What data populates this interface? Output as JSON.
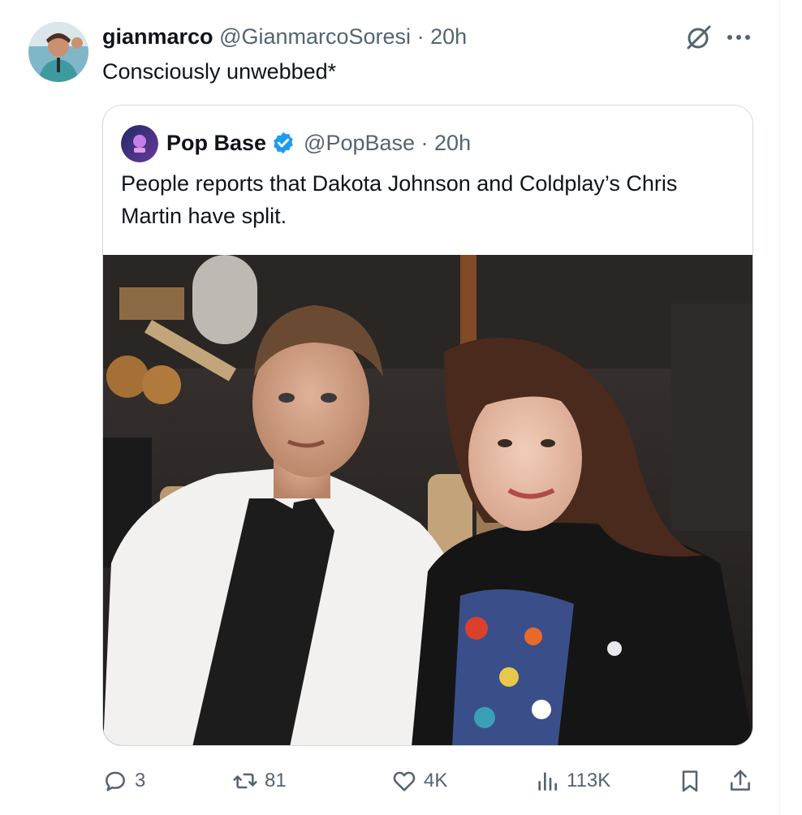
{
  "tweet": {
    "author_name": "gianmarco",
    "handle": "@GianmarcoSoresi",
    "separator": "·",
    "time": "20h",
    "text": "Consciously unwebbed*"
  },
  "quoted": {
    "author_name": "Pop Base",
    "handle_time": "@PopBase · 20h",
    "text": "People reports that Dakota Johnson and Coldplay’s Chris Martin have split.",
    "image_alt": "Chris Martin and Dakota Johnson seated together"
  },
  "actions": {
    "replies": "3",
    "retweets": "81",
    "likes": "4K",
    "views": "113K"
  },
  "colors": {
    "text": "#0f1419",
    "secondary": "#536471",
    "border": "#cfd9de",
    "verified": "#1d9bf0"
  },
  "icons": [
    "grok-icon",
    "more-icon",
    "verified-badge-icon",
    "reply-icon",
    "retweet-icon",
    "like-icon",
    "views-icon",
    "bookmark-icon",
    "share-icon"
  ]
}
